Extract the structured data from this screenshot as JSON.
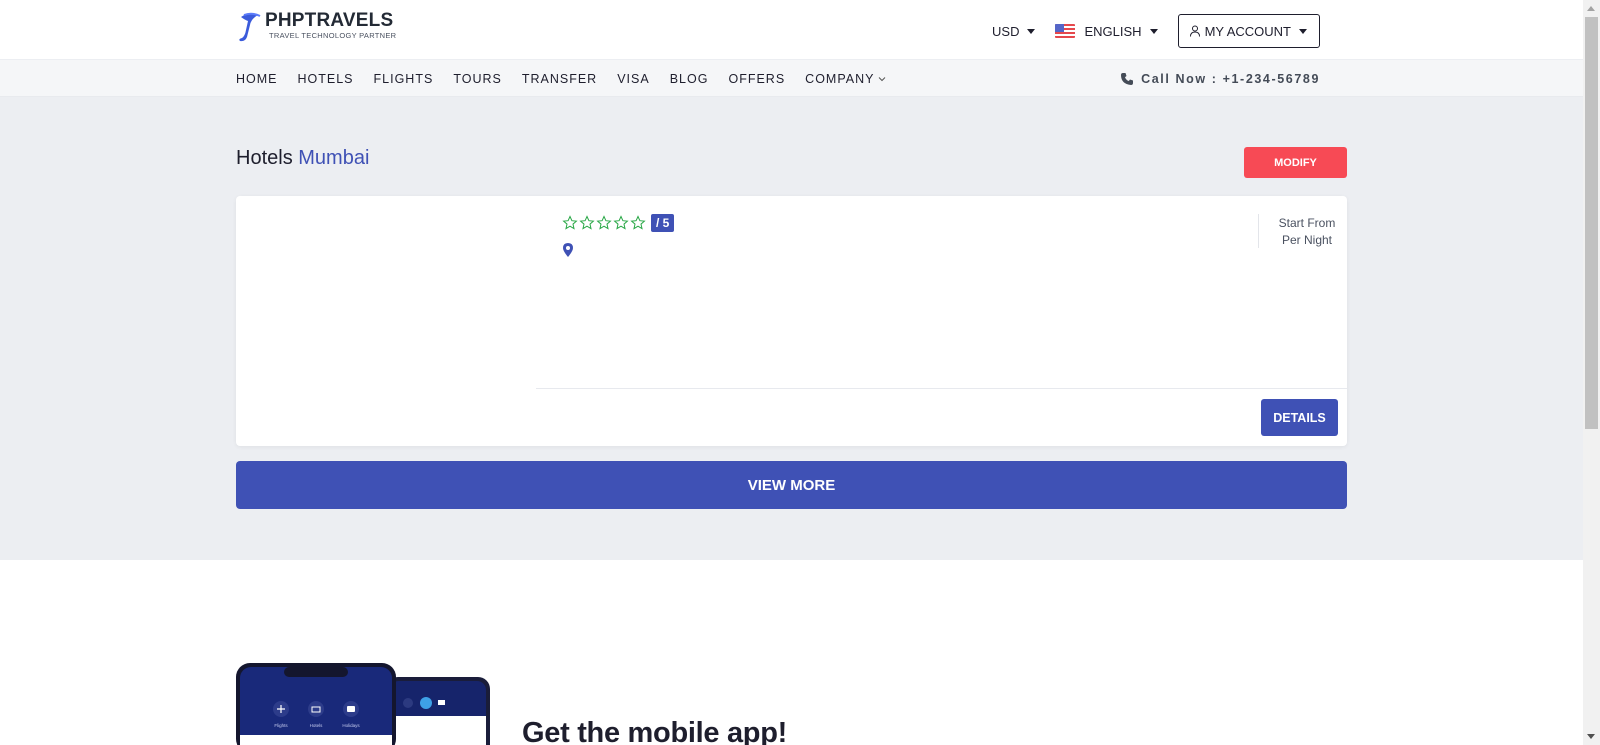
{
  "header": {
    "logo_title": "PHPTRAVELS",
    "logo_subtitle": "TRAVEL TECHNOLOGY PARTNER",
    "currency": "USD",
    "language": "ENGLISH",
    "account_label": "MY ACCOUNT"
  },
  "nav": {
    "items": [
      {
        "label": "HOME"
      },
      {
        "label": "HOTELS"
      },
      {
        "label": "FLIGHTS"
      },
      {
        "label": "TOURS"
      },
      {
        "label": "TRANSFER"
      },
      {
        "label": "VISA"
      },
      {
        "label": "BLOG"
      },
      {
        "label": "OFFERS"
      },
      {
        "label": "COMPANY"
      }
    ],
    "call_label": "Call Now : +1-234-56789"
  },
  "search": {
    "title_prefix": "Hotels",
    "city": "Mumbai",
    "modify_label": "MODIFY"
  },
  "result": {
    "rating_badge": "/ 5",
    "star_count": 5,
    "price_line1": "Start From",
    "price_line2": "Per Night",
    "details_label": "DETAILS"
  },
  "view_more_label": "VIEW MORE",
  "app_section": {
    "heading": "Get the mobile app!",
    "phone_labels": [
      "Flights",
      "Hotels",
      "Holidays"
    ]
  },
  "colors": {
    "primary": "#3f51b5",
    "danger": "#f74a55",
    "star_outline": "#28a745",
    "page_bg": "#eceef2"
  },
  "icons": [
    "user-icon",
    "phone-icon",
    "star-icon",
    "map-pin-icon",
    "chevron-down-icon",
    "us-flag-icon"
  ]
}
